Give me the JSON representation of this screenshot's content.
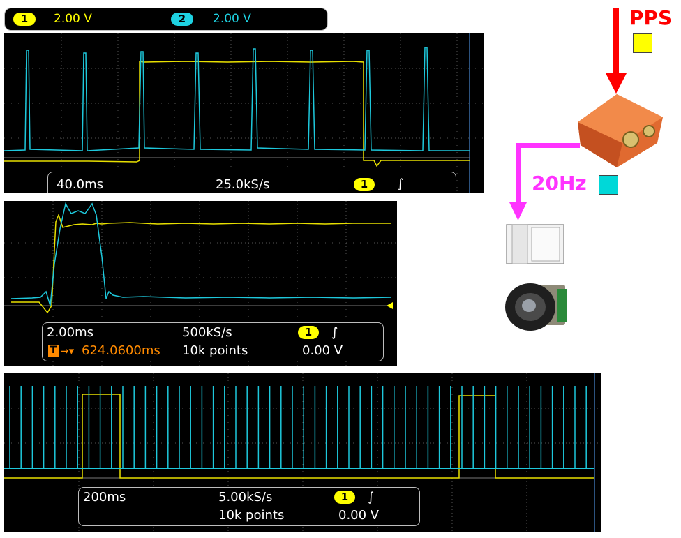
{
  "scope_top": {
    "ch1_badge": "1",
    "ch1_scale": "2.00 V",
    "ch2_badge": "2",
    "ch2_scale": "2.00 V",
    "timebase": "40.0ms",
    "sample_rate": "25.0kS/s",
    "trigger_badge": "1",
    "trigger_edge": "∫"
  },
  "scope_middle": {
    "timebase": "2.00ms",
    "sample_rate": "500kS/s",
    "trigger_badge": "1",
    "trigger_edge": "∫",
    "trigger_pos_icon": "T",
    "trigger_pos_arrow": "→▾",
    "trigger_pos": "624.0600ms",
    "record_length": "10k points",
    "trigger_level": "0.00 V"
  },
  "scope_bottom": {
    "timebase": "200ms",
    "sample_rate": "5.00kS/s",
    "trigger_badge": "1",
    "trigger_edge": "∫",
    "record_length": "10k points",
    "trigger_level": "0.00 V"
  },
  "diagram": {
    "pps_label": "PPS",
    "pps_color": "#ffff00",
    "hz_label": "20Hz",
    "hz_color": "#00d8d8"
  },
  "colors": {
    "ch1": "#e8e000",
    "ch2": "#1ec8dc",
    "arrow_pps": "#ff0000",
    "arrow_20hz": "#ff33ff"
  }
}
